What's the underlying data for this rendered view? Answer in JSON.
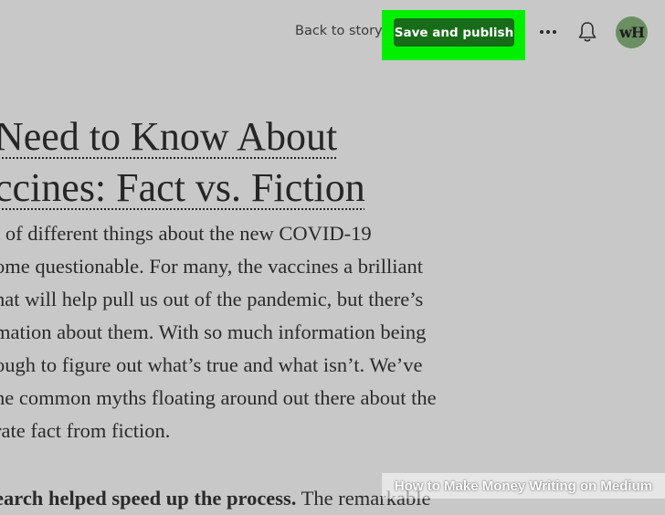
{
  "header": {
    "back_label": "Back to story",
    "publish_label": "Save and publish",
    "avatar_initials": "wH",
    "icons": [
      "more-icon",
      "bell-icon"
    ],
    "highlight_color": "#00f000",
    "publish_color": "#176c17"
  },
  "article": {
    "title_lines": [
      "Need to Know About",
      "ccines: Fact vs. Fiction"
    ],
    "body_lines": [
      "t of different things about the new COVID-19",
      "ome questionable. For many, the vaccines a brilliant",
      "hat will help pull us out of the pandemic, but there’s",
      "mation about them. With so much information being",
      "ough to figure out what’s true and what isn’t. We’ve",
      "he common myths floating around out there about the",
      "rate fact from fiction."
    ],
    "last_line_bold": "earch helped speed up the process.",
    "last_line_rest": " The remarkable"
  },
  "watermark": {
    "text": "How to Make Money Writing on Medium"
  }
}
